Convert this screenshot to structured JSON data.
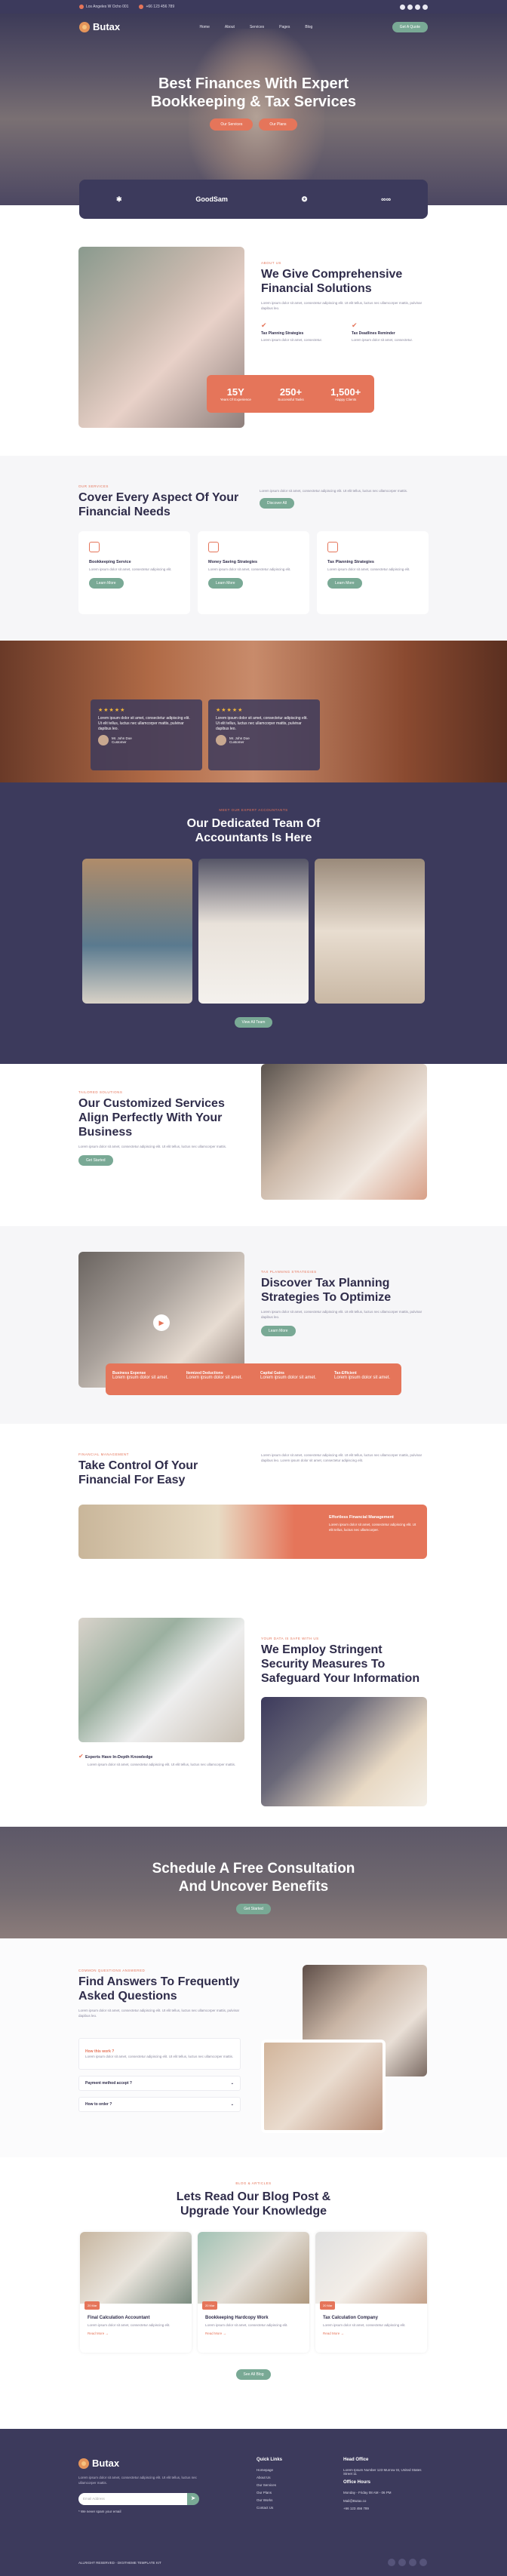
{
  "topbar": {
    "address": "Los Angeles W Ocho 001",
    "phone": "+66 123 456 789"
  },
  "nav": {
    "logo": "Butax",
    "menu": [
      "Home",
      "About",
      "Services",
      "Pages",
      "Blog",
      "Pages"
    ],
    "cta": "Get A Quote"
  },
  "hero": {
    "title": "Best Finances With Expert Bookkeeping & Tax Services",
    "btn1": "Our Services",
    "btn2": "Our Plans"
  },
  "brands": [
    "✱",
    "GoodSam",
    "❂",
    "∞∞"
  ],
  "about": {
    "label": "About Us",
    "title": "We Give Comprehensive Financial Solutions",
    "text": "Lorem ipsum dolor sit amet, consectetur adipiscing elit. Ut elit tellus, luctus nec ullamcorper mattis, pulvinar dapibus leo.",
    "f1": "Tax Planning Strategies",
    "f2": "Tax Deadlines Reminder",
    "ftext": "Lorem ipsum dolor sit amet, consectetur.",
    "stats": [
      {
        "n": "15Y",
        "l": "Years Of Experience"
      },
      {
        "n": "250+",
        "l": "Successful Tasks"
      },
      {
        "n": "1,500+",
        "l": "Happy Clients"
      }
    ]
  },
  "services": {
    "label": "Our Services",
    "title": "Cover Every Aspect Of Your Financial Needs",
    "text": "Lorem ipsum dolor sit amet, consectetur adipiscing elit. Ut elit tellus, luctus nec ullamcorper mattis.",
    "btn": "Discover All",
    "cards": [
      {
        "t": "Bookkeeping Service",
        "d": "Lorem ipsum dolor sit amet, consectetur adipiscing elit.",
        "b": "Learn More"
      },
      {
        "t": "Money Saving Strategies",
        "d": "Lorem ipsum dolor sit amet, consectetur adipiscing elit.",
        "b": "Learn More"
      },
      {
        "t": "Tax Planning Strategies",
        "d": "Lorem ipsum dolor sit amet, consectetur adipiscing elit.",
        "b": "Learn More"
      }
    ]
  },
  "testimonials": [
    {
      "stars": "★★★★★",
      "q": "Lorem ipsum dolor sit amet, consectetur adipiscing elit. Ut elit tellus, luctus nec ullamcorper mattis, pulvinar dapibus leo.",
      "name": "Mr. John Doe",
      "role": "Customer"
    },
    {
      "stars": "★★★★★",
      "q": "Lorem ipsum dolor sit amet, consectetur adipiscing elit. Ut elit tellus, luctus nec ullamcorper mattis, pulvinar dapibus leo.",
      "name": "Mr. John Doe",
      "role": "Customer"
    }
  ],
  "team": {
    "label": "Meet Our Expert Accountants",
    "title": "Our Dedicated Team Of Accountants Is Here",
    "btn": "View All Team"
  },
  "custom": {
    "label": "Tailored Solutions",
    "title": "Our Customized Services Align Perfectly With Your Business",
    "text": "Lorem ipsum dolor sit amet, consectetur adipiscing elit. Ut elit tellus, luctus nec ullamcorper mattis.",
    "btn": "Get Started"
  },
  "tax": {
    "label": "Tax Planning Strategies",
    "title": "Discover Tax Planning Strategies To Optimize",
    "text": "Lorem ipsum dolor sit amet, consectetur adipiscing elit. Ut elit tellus, luctus nec ullamcorper mattis, pulvinar dapibus leo.",
    "btn": "Learn More",
    "items": [
      {
        "t": "Business Expense",
        "d": "Lorem ipsum dolor sit amet."
      },
      {
        "t": "Itemized Deductions",
        "d": "Lorem ipsum dolor sit amet."
      },
      {
        "t": "Capital Gains",
        "d": "Lorem ipsum dolor sit amet."
      },
      {
        "t": "Tax-Efficient",
        "d": "Lorem ipsum dolor sit amet."
      }
    ]
  },
  "control": {
    "label": "Financial Management",
    "title": "Take Control Of Your Financial For Easy",
    "text": "Lorem ipsum dolor sit amet, consectetur adipiscing elit. Ut elit tellus, luctus nec ullamcorper mattis, pulvinar dapibus leo. Lorem ipsum dolor sit amet, consectetur adipiscing elit.",
    "box_t": "Effortless Financial Management",
    "box_d": "Lorem ipsum dolor sit amet, consectetur adipiscing elit. Ut elit tellus, luctus nec ullamcorper."
  },
  "security": {
    "label": "Your Data Is Safe With Us",
    "title": "We Employ Stringent Security Measures To Safeguard Your Information",
    "text": "Lorem ipsum dolor sit amet, consectetur adipiscing elit. Ut elit tellus, luctus nec ullamcorper mattis.",
    "feat_t": "Experts Have In-Depth Knowledge",
    "feat_d": "Lorem ipsum dolor sit amet, consectetur adipiscing elit. Ut elit tellus, luctus nec ullamcorper mattis."
  },
  "consult": {
    "title": "Schedule A Free Consultation And Uncover Benefits",
    "btn": "Get Started"
  },
  "faq": {
    "label": "Common Questions Answered",
    "title": "Find Answers To Frequently Asked Questions",
    "text": "Lorem ipsum dolor sit amet, consectetur adipiscing elit. Ut elit tellus, luctus nec ullamcorper mattis, pulvinar dapibus leo.",
    "items": [
      "How this work ?",
      "Payment method accept ?",
      "How to order ?"
    ],
    "answer": "Lorem ipsum dolor sit amet, consectetur adipiscing elit. Ut elit tellus, luctus nec ullamcorper mattis."
  },
  "blog": {
    "label": "Blog & Articles",
    "title": "Lets Read Our Blog Post & Upgrade Your Knowledge",
    "btn": "See All Blog",
    "posts": [
      {
        "d": "20 Mar",
        "t": "Final Calculation Accountant",
        "x": "Lorem ipsum dolor sit amet, consectetur adipiscing elit.",
        "m": "Read More →"
      },
      {
        "d": "20 Mar",
        "t": "Bookkeeping Hardcopy Work",
        "x": "Lorem ipsum dolor sit amet, consectetur adipiscing elit.",
        "m": "Read More →"
      },
      {
        "d": "20 Mar",
        "t": "Tax Calculation Company",
        "x": "Lorem ipsum dolor sit amet, consectetur adipiscing elit.",
        "m": "Read More →"
      }
    ]
  },
  "footer": {
    "logo": "Butax",
    "text": "Lorem ipsum dolor sit amet, consectetur adipiscing elit. Ut elit tellus, luctus nec ullamcorper mattis.",
    "placeholder": "Email Address",
    "note": "* We never spam your email",
    "links_title": "Quick Links",
    "links": [
      "Homepage",
      "About Us",
      "Our Services",
      "Our Plans",
      "Our Works",
      "Contact Us"
    ],
    "office_title": "Head Office",
    "address": "Lorem Ipsum Number 123 Murrow St, United States Street 11",
    "hours_title": "Office Hours",
    "hours": "Monday - Friday 08 AM - 06 PM",
    "email": "Mail@Butax.co",
    "phone": "+66 123 456 789",
    "copyright": "ALLRIGHT RESERVED - DIGITHEME TEMPLATE KIT"
  },
  "colors": {
    "navy": "#3c3a5c",
    "accent": "#e5755a",
    "green": "#79a995"
  }
}
